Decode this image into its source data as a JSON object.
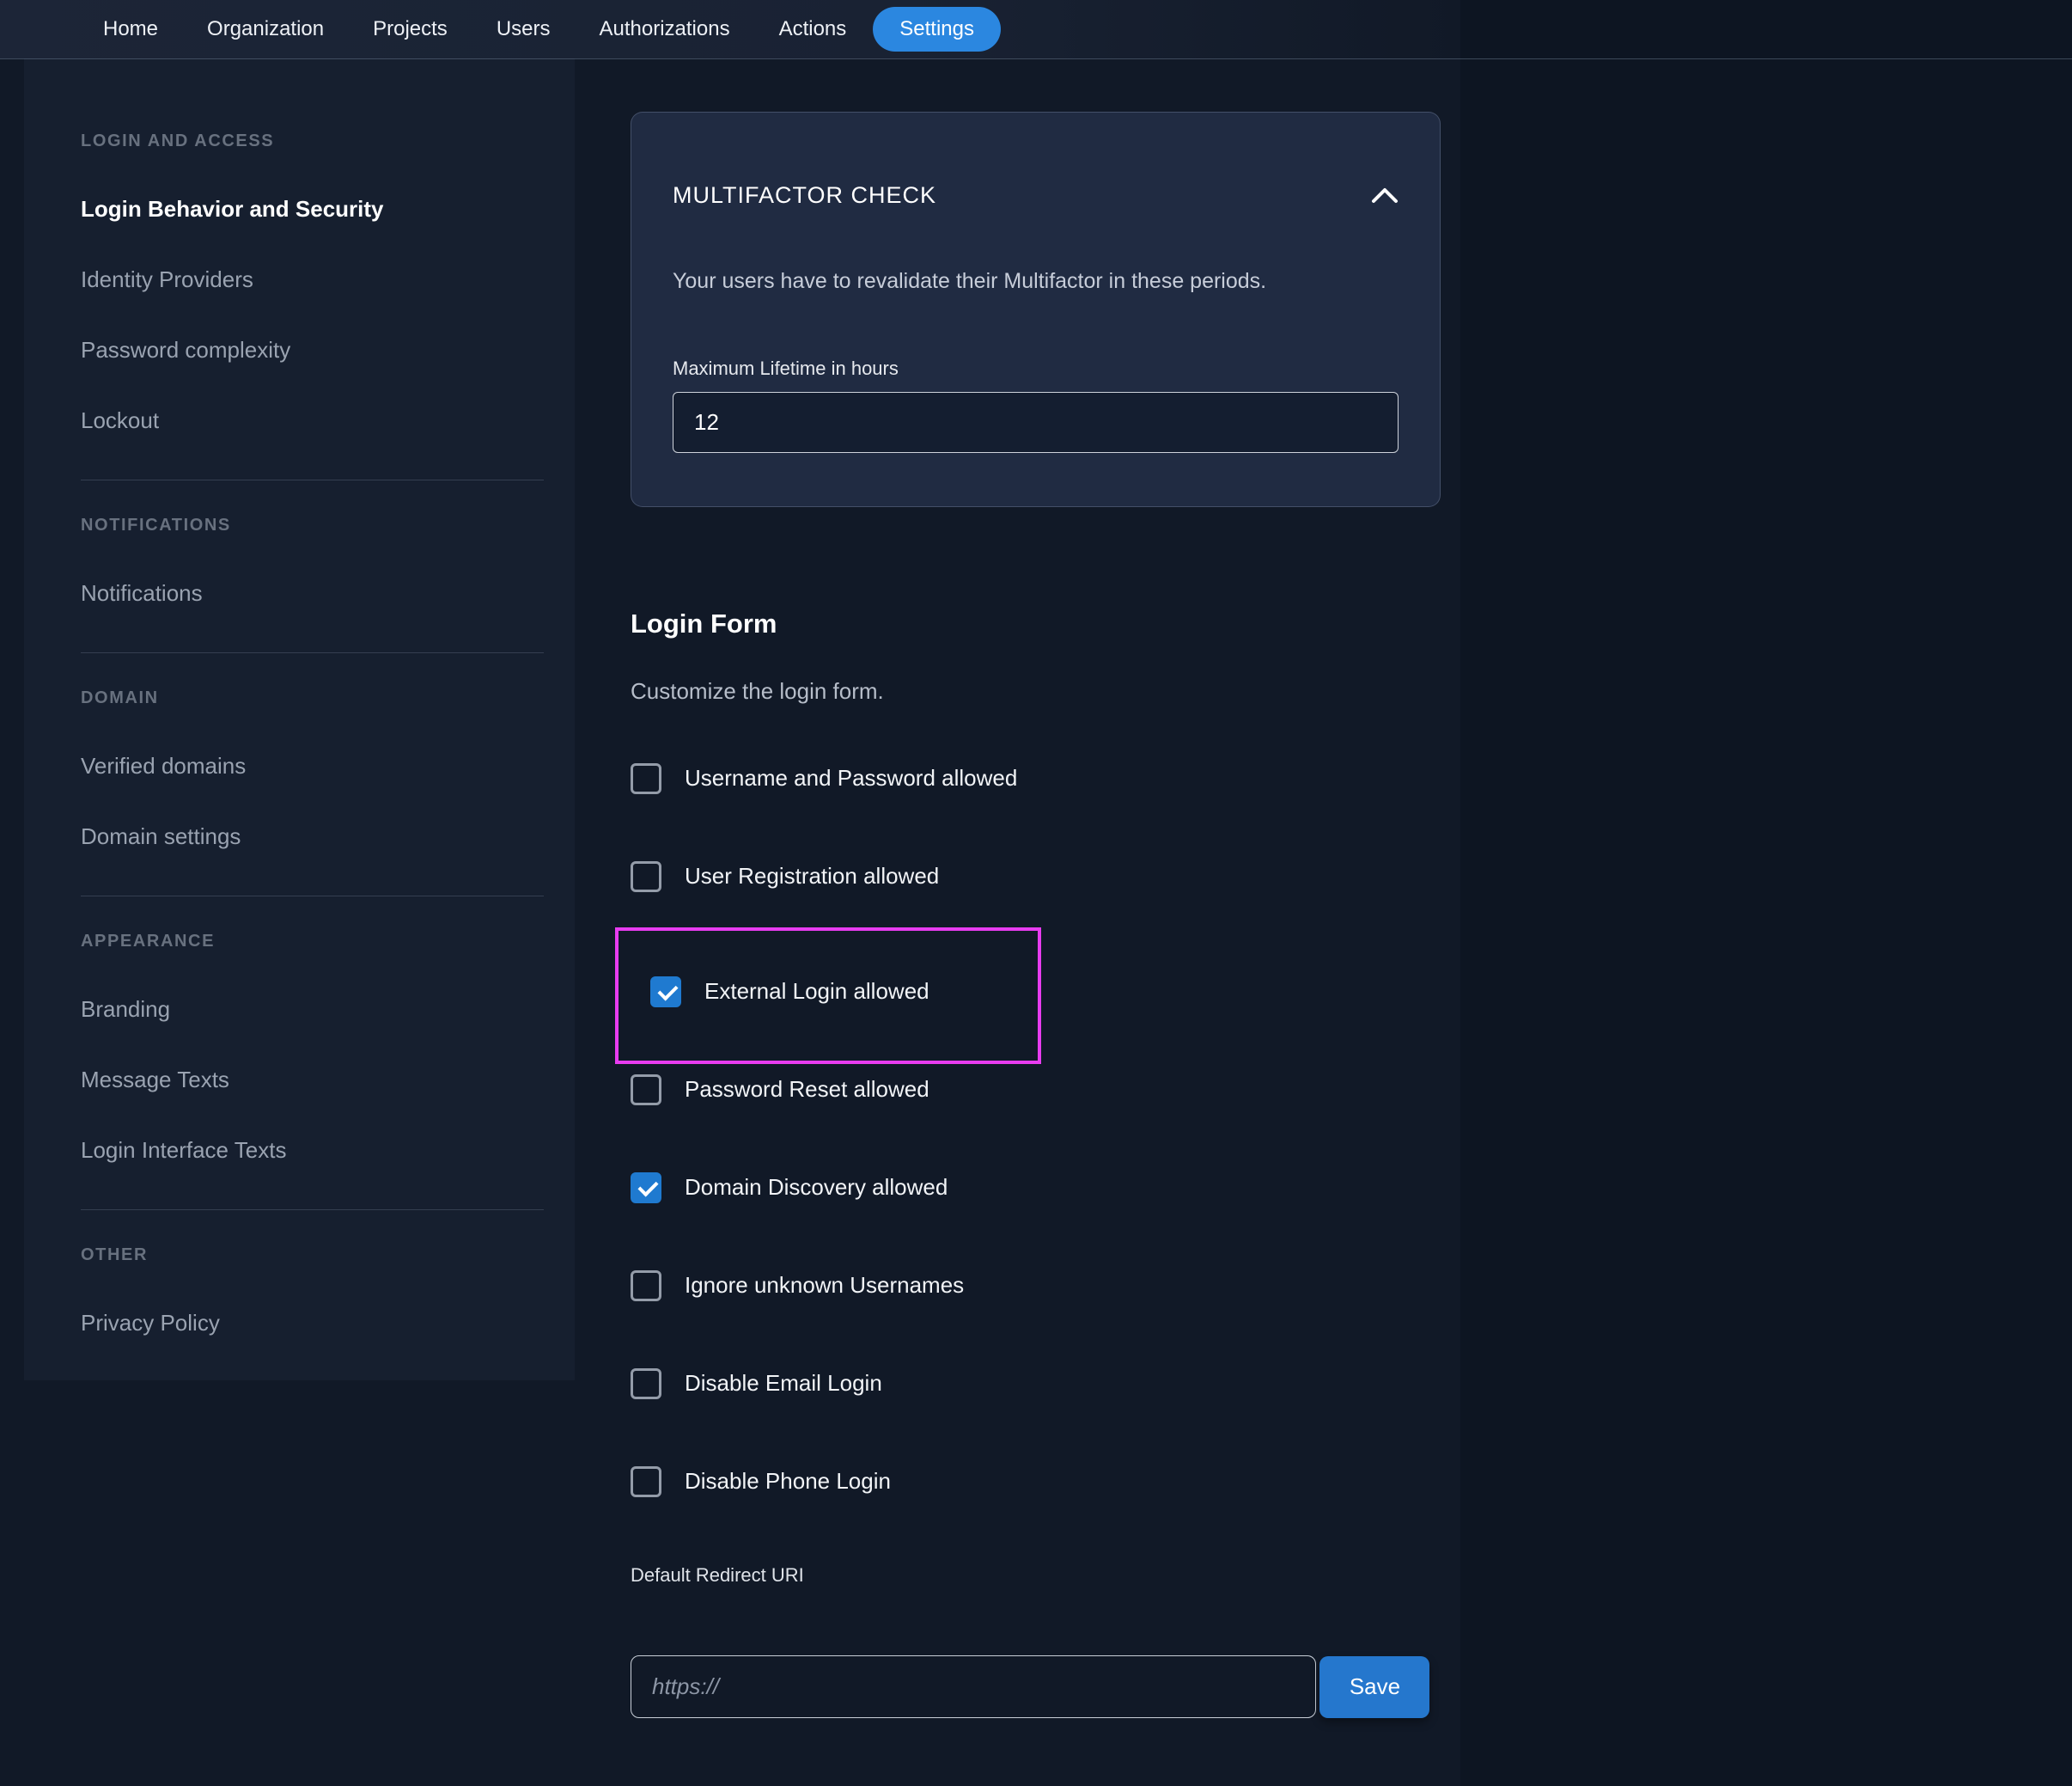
{
  "nav": {
    "items": [
      {
        "label": "Home"
      },
      {
        "label": "Organization"
      },
      {
        "label": "Projects"
      },
      {
        "label": "Users"
      },
      {
        "label": "Authorizations"
      },
      {
        "label": "Actions"
      }
    ],
    "active_item": "Settings"
  },
  "sidebar": {
    "sections": [
      {
        "header": "LOGIN AND ACCESS",
        "items": [
          {
            "label": "Login Behavior and Security",
            "active": true
          },
          {
            "label": "Identity Providers"
          },
          {
            "label": "Password complexity"
          },
          {
            "label": "Lockout"
          }
        ]
      },
      {
        "header": "NOTIFICATIONS",
        "items": [
          {
            "label": "Notifications"
          }
        ]
      },
      {
        "header": "DOMAIN",
        "items": [
          {
            "label": "Verified domains"
          },
          {
            "label": "Domain settings"
          }
        ]
      },
      {
        "header": "APPEARANCE",
        "items": [
          {
            "label": "Branding"
          },
          {
            "label": "Message Texts"
          },
          {
            "label": "Login Interface Texts"
          }
        ]
      },
      {
        "header": "OTHER",
        "items": [
          {
            "label": "Privacy Policy"
          }
        ]
      }
    ]
  },
  "multifactor_card": {
    "title": "MULTIFACTOR CHECK",
    "collapse_icon": "chevron-up-icon",
    "description": "Your users have to revalidate their Multifactor in these periods.",
    "lifetime_label": "Maximum Lifetime in hours",
    "lifetime_value": "12"
  },
  "login_form": {
    "title": "Login Form",
    "subtitle": "Customize the login form.",
    "options": [
      {
        "label": "Username and Password allowed",
        "checked": false
      },
      {
        "label": "User Registration allowed",
        "checked": false
      },
      {
        "label": "External Login allowed",
        "checked": true,
        "highlighted": true
      },
      {
        "label": "Password Reset allowed",
        "checked": false
      },
      {
        "label": "Domain Discovery allowed",
        "checked": true
      },
      {
        "label": "Ignore unknown Usernames",
        "checked": false
      },
      {
        "label": "Disable Email Login",
        "checked": false
      },
      {
        "label": "Disable Phone Login",
        "checked": false
      }
    ],
    "redirect_label": "Default Redirect URI",
    "redirect_placeholder": "https://",
    "save_label": "Save"
  },
  "colors": {
    "accent_blue": "#2b87e0",
    "checkbox_blue": "#1f7ad0",
    "save_blue": "#2577cd",
    "highlight_magenta": "#e83cf0"
  }
}
